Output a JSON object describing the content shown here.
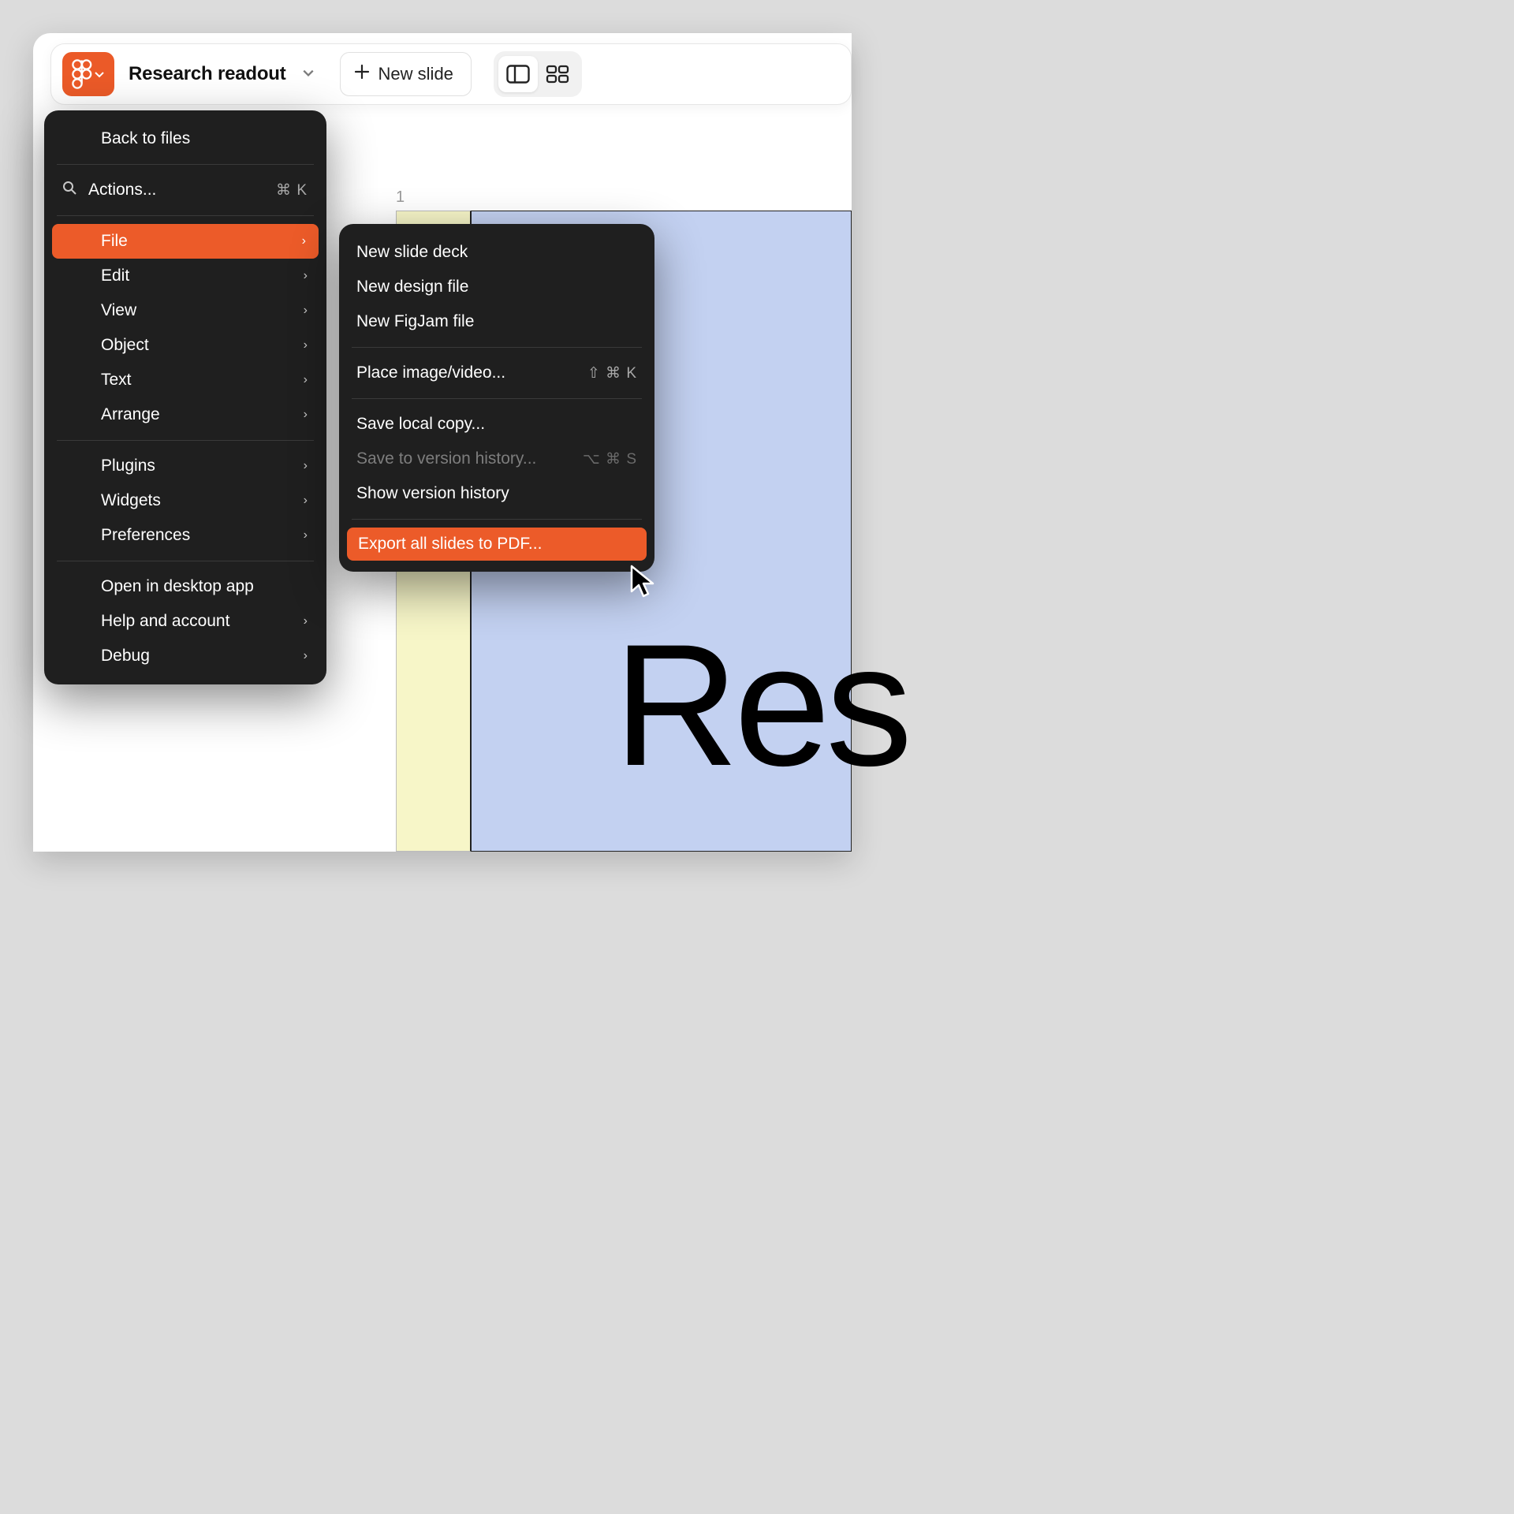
{
  "toolbar": {
    "doc_title": "Research readout",
    "new_slide_label": "New slide"
  },
  "slide": {
    "index": "1",
    "title_fragment": "Res"
  },
  "main_menu": {
    "back": "Back to files",
    "actions": "Actions...",
    "actions_shortcut": "⌘ K",
    "file": "File",
    "edit": "Edit",
    "view": "View",
    "object": "Object",
    "text": "Text",
    "arrange": "Arrange",
    "plugins": "Plugins",
    "widgets": "Widgets",
    "preferences": "Preferences",
    "open_desktop": "Open in desktop app",
    "help": "Help and account",
    "debug": "Debug"
  },
  "file_menu": {
    "new_slide_deck": "New slide deck",
    "new_design_file": "New design file",
    "new_figjam_file": "New FigJam file",
    "place_media": "Place image/video...",
    "place_media_shortcut": "⇧ ⌘ K",
    "save_local": "Save local copy...",
    "save_version": "Save to version history...",
    "save_version_shortcut": "⌥ ⌘ S",
    "show_history": "Show version history",
    "export_pdf": "Export all slides to PDF..."
  }
}
